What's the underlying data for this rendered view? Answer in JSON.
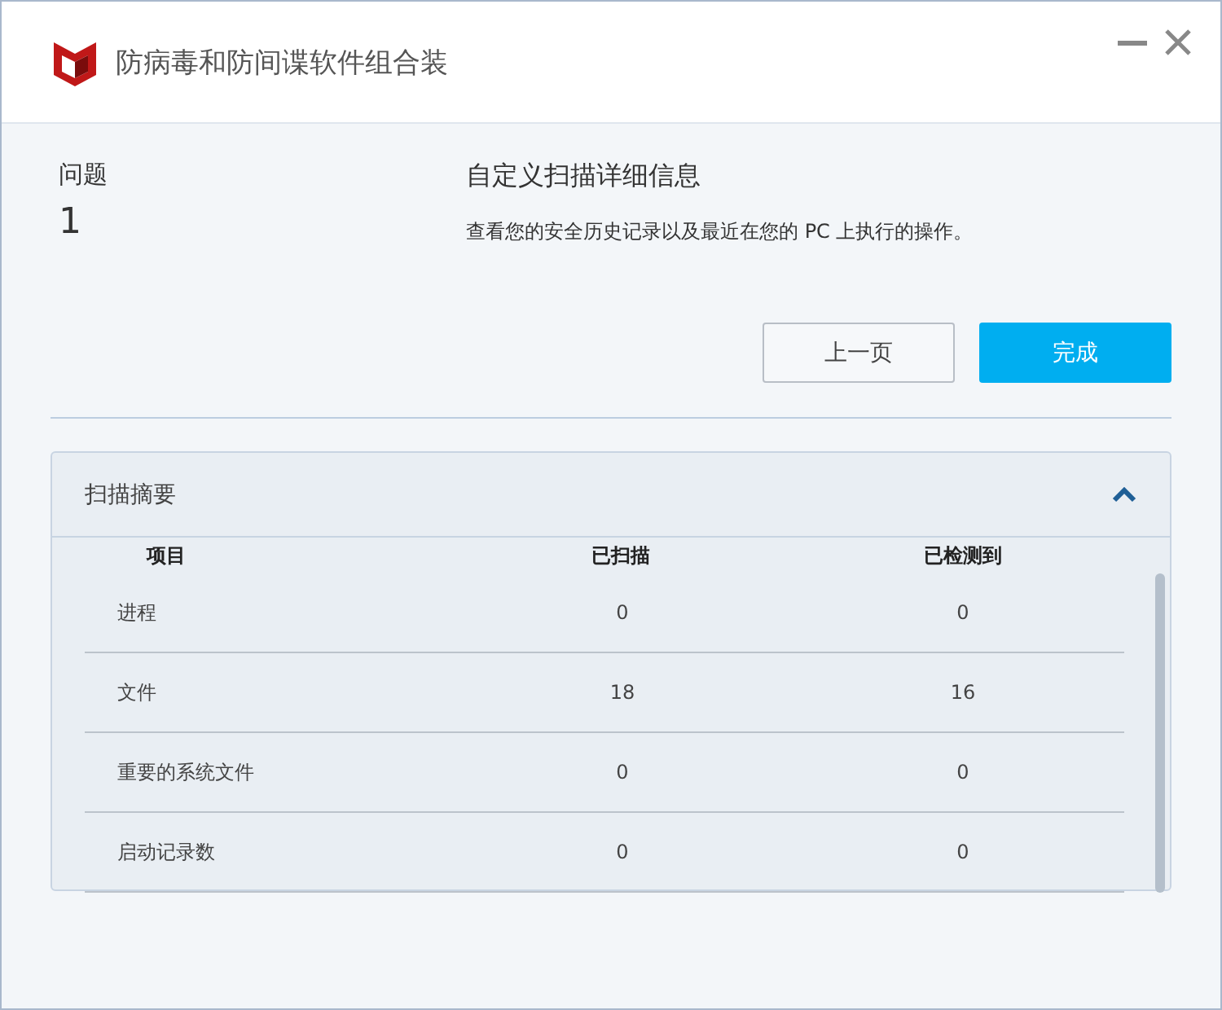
{
  "window": {
    "title": "防病毒和防间谍软件组合装"
  },
  "issues": {
    "label": "问题",
    "count": "1"
  },
  "details": {
    "title": "自定义扫描详细信息",
    "description": "查看您的安全历史记录以及最近在您的 PC 上执行的操作。"
  },
  "buttons": [
    {
      "label": "上一页",
      "kind": "secondary"
    },
    {
      "label": "完成",
      "kind": "primary"
    }
  ],
  "summary": {
    "title": "扫描摘要",
    "expanded": true,
    "columns": [
      "项目",
      "已扫描",
      "已检测到"
    ],
    "rows": [
      {
        "item": "进程",
        "scanned": "0",
        "detected": "0"
      },
      {
        "item": "文件",
        "scanned": "18",
        "detected": "16"
      },
      {
        "item": "重要的系统文件",
        "scanned": "0",
        "detected": "0"
      },
      {
        "item": "启动记录数",
        "scanned": "0",
        "detected": "0"
      }
    ]
  }
}
